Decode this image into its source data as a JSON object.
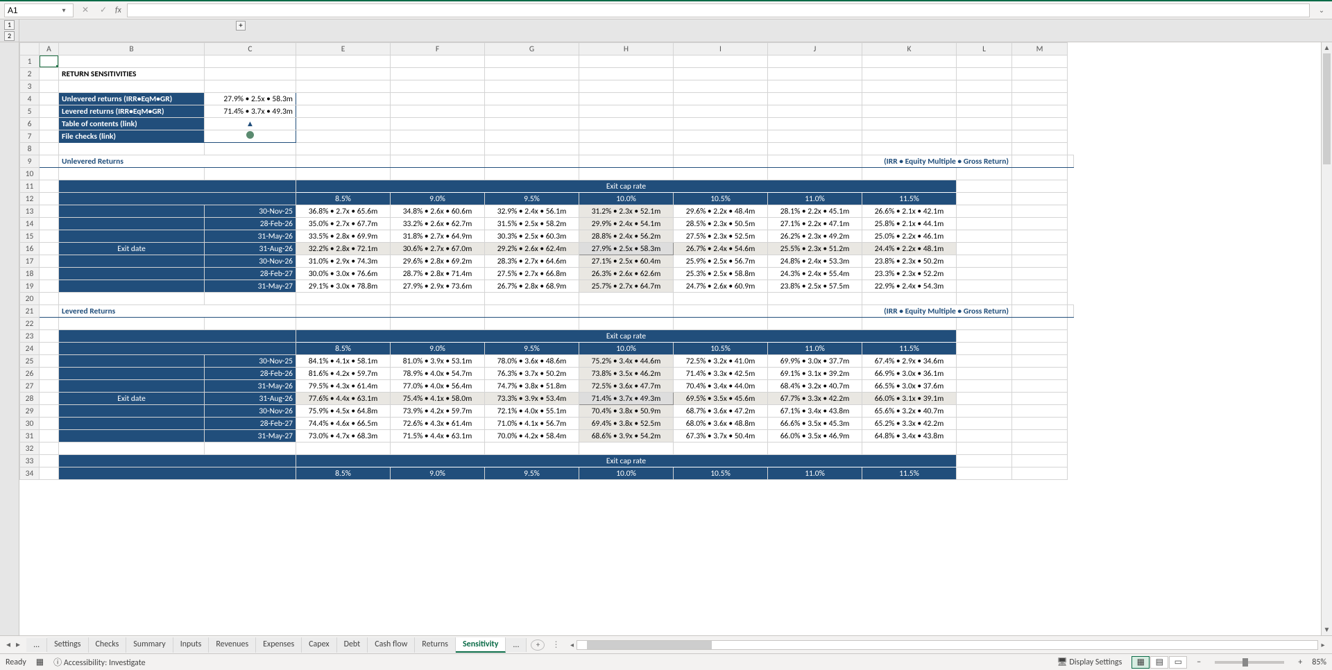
{
  "nameBox": "A1",
  "fx": "fx",
  "outlineLevels": [
    "1",
    "2"
  ],
  "outlinePlus": "+",
  "columns": [
    "A",
    "B",
    "C",
    "E",
    "F",
    "G",
    "H",
    "I",
    "J",
    "K",
    "L",
    "M"
  ],
  "rowNumbers": [
    "1",
    "2",
    "3",
    "4",
    "5",
    "6",
    "7",
    "8",
    "9",
    "10",
    "11",
    "12",
    "13",
    "14",
    "15",
    "16",
    "17",
    "18",
    "19",
    "20",
    "21",
    "22",
    "23",
    "24",
    "25",
    "26",
    "27",
    "28",
    "29",
    "30",
    "31",
    "32",
    "33",
    "34"
  ],
  "title": "RETURN SENSITIVITIES",
  "summary": [
    {
      "label": "Unlevered returns (IRR•EqM•GR)",
      "value": "27.9% • 2.5x • 58.3m"
    },
    {
      "label": "Levered returns (IRR•EqM•GR)",
      "value": "71.4% • 3.7x • 49.3m"
    },
    {
      "label": "Table of contents (link)",
      "value": "▲",
      "icon": "tri"
    },
    {
      "label": "File checks (link)",
      "value": "",
      "icon": "circ"
    }
  ],
  "section1": {
    "title": "Unlevered Returns",
    "right": "(IRR • Equity Multiple • Gross Return)"
  },
  "section2": {
    "title": "Levered Returns",
    "right": "(IRR • Equity Multiple • Gross Return)"
  },
  "colHeader": "Exit cap rate",
  "rowHeader": "Exit date",
  "caps": [
    "8.5%",
    "9.0%",
    "9.5%",
    "10.0%",
    "10.5%",
    "11.0%",
    "11.5%"
  ],
  "dates": [
    "30-Nov-25",
    "28-Feb-26",
    "31-May-26",
    "31-Aug-26",
    "30-Nov-26",
    "28-Feb-27",
    "31-May-27"
  ],
  "chart_data": [
    {
      "type": "table",
      "title": "Unlevered Returns",
      "row_axis": "Exit date",
      "col_axis": "Exit cap rate",
      "columns": [
        "8.5%",
        "9.0%",
        "9.5%",
        "10.0%",
        "10.5%",
        "11.0%",
        "11.5%"
      ],
      "rows": [
        "30-Nov-25",
        "28-Feb-26",
        "31-May-26",
        "31-Aug-26",
        "30-Nov-26",
        "28-Feb-27",
        "31-May-27"
      ],
      "cells": [
        [
          "36.8% • 2.7x • 65.6m",
          "34.8% • 2.6x • 60.6m",
          "32.9% • 2.4x • 56.1m",
          "31.2% • 2.3x • 52.1m",
          "29.6% • 2.2x • 48.4m",
          "28.1% • 2.2x • 45.1m",
          "26.6% • 2.1x • 42.1m"
        ],
        [
          "35.0% • 2.7x • 67.7m",
          "33.2% • 2.6x • 62.7m",
          "31.5% • 2.5x • 58.2m",
          "29.9% • 2.4x • 54.1m",
          "28.5% • 2.3x • 50.5m",
          "27.1% • 2.2x • 47.1m",
          "25.8% • 2.1x • 44.1m"
        ],
        [
          "33.5% • 2.8x • 69.9m",
          "31.8% • 2.7x • 64.9m",
          "30.3% • 2.5x • 60.3m",
          "28.8% • 2.4x • 56.2m",
          "27.5% • 2.3x • 52.5m",
          "26.2% • 2.3x • 49.2m",
          "25.0% • 2.2x • 46.1m"
        ],
        [
          "32.2% • 2.8x • 72.1m",
          "30.6% • 2.7x • 67.0m",
          "29.2% • 2.6x • 62.4m",
          "27.9% • 2.5x • 58.3m",
          "26.7% • 2.4x • 54.6m",
          "25.5% • 2.3x • 51.2m",
          "24.4% • 2.2x • 48.1m"
        ],
        [
          "31.0% • 2.9x • 74.3m",
          "29.6% • 2.8x • 69.2m",
          "28.3% • 2.7x • 64.6m",
          "27.1% • 2.5x • 60.4m",
          "25.9% • 2.5x • 56.7m",
          "24.8% • 2.4x • 53.3m",
          "23.8% • 2.3x • 50.2m"
        ],
        [
          "30.0% • 3.0x • 76.6m",
          "28.7% • 2.8x • 71.4m",
          "27.5% • 2.7x • 66.8m",
          "26.3% • 2.6x • 62.6m",
          "25.3% • 2.5x • 58.8m",
          "24.3% • 2.4x • 55.4m",
          "23.3% • 2.3x • 52.2m"
        ],
        [
          "29.1% • 3.0x • 78.8m",
          "27.9% • 2.9x • 73.6m",
          "26.7% • 2.8x • 68.9m",
          "25.7% • 2.7x • 64.7m",
          "24.7% • 2.6x • 60.9m",
          "23.8% • 2.5x • 57.5m",
          "22.9% • 2.4x • 54.3m"
        ]
      ],
      "highlight": {
        "row": 3,
        "col": 3
      }
    },
    {
      "type": "table",
      "title": "Levered Returns",
      "row_axis": "Exit date",
      "col_axis": "Exit cap rate",
      "columns": [
        "8.5%",
        "9.0%",
        "9.5%",
        "10.0%",
        "10.5%",
        "11.0%",
        "11.5%"
      ],
      "rows": [
        "30-Nov-25",
        "28-Feb-26",
        "31-May-26",
        "31-Aug-26",
        "30-Nov-26",
        "28-Feb-27",
        "31-May-27"
      ],
      "cells": [
        [
          "84.1% • 4.1x • 58.1m",
          "81.0% • 3.9x • 53.1m",
          "78.0% • 3.6x • 48.6m",
          "75.2% • 3.4x • 44.6m",
          "72.5% • 3.2x • 41.0m",
          "69.9% • 3.0x • 37.7m",
          "67.4% • 2.9x • 34.6m"
        ],
        [
          "81.6% • 4.2x • 59.7m",
          "78.9% • 4.0x • 54.7m",
          "76.3% • 3.7x • 50.2m",
          "73.8% • 3.5x • 46.2m",
          "71.4% • 3.3x • 42.5m",
          "69.1% • 3.1x • 39.2m",
          "66.9% • 3.0x • 36.1m"
        ],
        [
          "79.5% • 4.3x • 61.4m",
          "77.0% • 4.0x • 56.4m",
          "74.7% • 3.8x • 51.8m",
          "72.5% • 3.6x • 47.7m",
          "70.4% • 3.4x • 44.0m",
          "68.4% • 3.2x • 40.7m",
          "66.5% • 3.0x • 37.6m"
        ],
        [
          "77.6% • 4.4x • 63.1m",
          "75.4% • 4.1x • 58.0m",
          "73.3% • 3.9x • 53.4m",
          "71.4% • 3.7x • 49.3m",
          "69.5% • 3.5x • 45.6m",
          "67.7% • 3.3x • 42.2m",
          "66.0% • 3.1x • 39.1m"
        ],
        [
          "75.9% • 4.5x • 64.8m",
          "73.9% • 4.2x • 59.7m",
          "72.1% • 4.0x • 55.1m",
          "70.4% • 3.8x • 50.9m",
          "68.7% • 3.6x • 47.2m",
          "67.1% • 3.4x • 43.8m",
          "65.6% • 3.2x • 40.7m"
        ],
        [
          "74.4% • 4.6x • 66.5m",
          "72.6% • 4.3x • 61.4m",
          "71.0% • 4.1x • 56.7m",
          "69.4% • 3.8x • 52.5m",
          "68.0% • 3.6x • 48.8m",
          "66.6% • 3.5x • 45.3m",
          "65.2% • 3.3x • 42.2m"
        ],
        [
          "73.0% • 4.7x • 68.3m",
          "71.5% • 4.4x • 63.1m",
          "70.0% • 4.2x • 58.4m",
          "68.6% • 3.9x • 54.2m",
          "67.3% • 3.7x • 50.4m",
          "66.0% • 3.5x • 46.9m",
          "64.8% • 3.4x • 43.8m"
        ]
      ],
      "highlight": {
        "row": 3,
        "col": 3
      }
    }
  ],
  "tabs": {
    "ellipsis": "...",
    "items": [
      "Settings",
      "Checks",
      "Summary",
      "Inputs",
      "Revenues",
      "Expenses",
      "Capex",
      "Debt",
      "Cash flow",
      "Returns",
      "Sensitivity"
    ],
    "active": "Sensitivity",
    "moreEllipsis": "..."
  },
  "status": {
    "ready": "Ready",
    "accessibility": "Accessibility: Investigate",
    "display": "Display Settings",
    "zoom": "85%",
    "minus": "−",
    "plus": "+"
  }
}
